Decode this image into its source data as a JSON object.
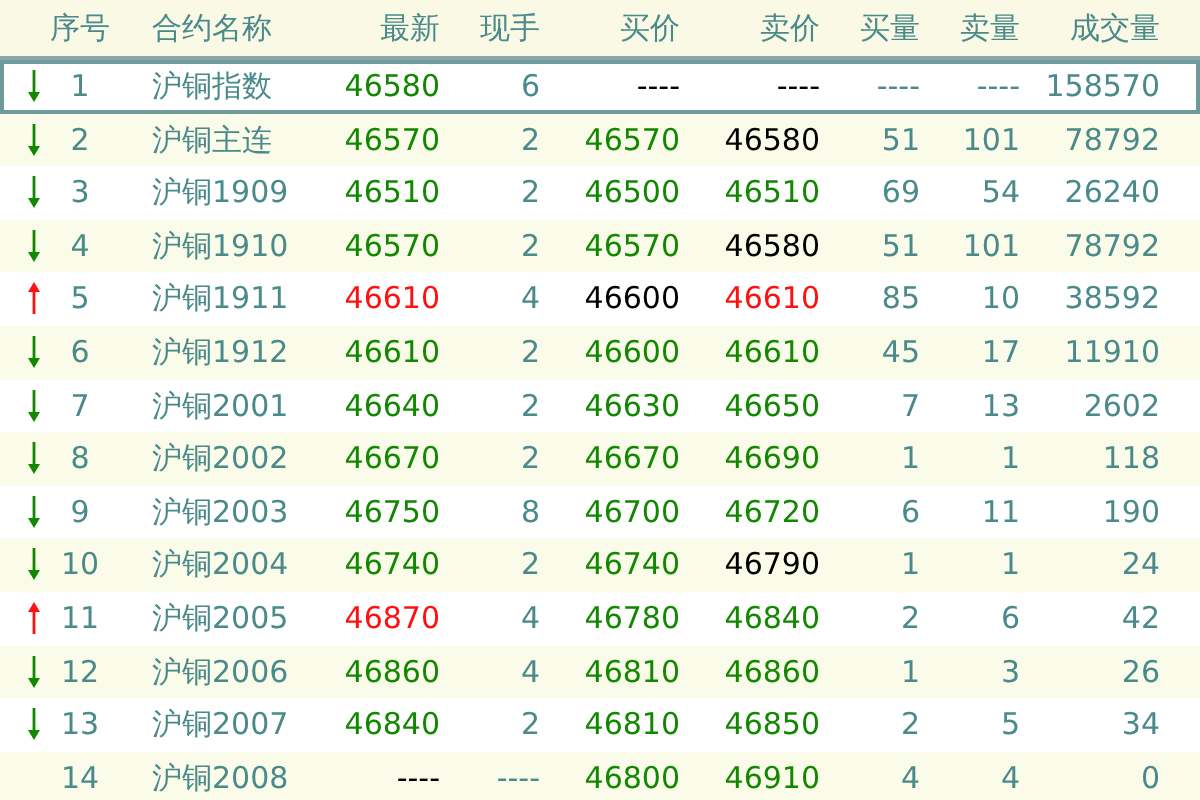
{
  "columns": [
    "序号",
    "合约名称",
    "最新",
    "现手",
    "买价",
    "卖价",
    "买量",
    "卖量",
    "成交量"
  ],
  "rows": [
    {
      "selected": true,
      "arrow": {
        "up": false,
        "color": "#118800"
      },
      "index": "1",
      "name": "沪铜指数",
      "last": {
        "text": "46580",
        "color": "#118800"
      },
      "hand": "6",
      "bid": {
        "text": "----",
        "color": "#000000"
      },
      "ask": {
        "text": "----",
        "color": "#000000"
      },
      "bid_vol": "----",
      "ask_vol": "----",
      "volume": "158570"
    },
    {
      "selected": false,
      "arrow": {
        "up": false,
        "color": "#118800"
      },
      "index": "2",
      "name": "沪铜主连",
      "last": {
        "text": "46570",
        "color": "#118800"
      },
      "hand": "2",
      "bid": {
        "text": "46570",
        "color": "#118800"
      },
      "ask": {
        "text": "46580",
        "color": "#000000"
      },
      "bid_vol": "51",
      "ask_vol": "101",
      "volume": "78792"
    },
    {
      "selected": false,
      "arrow": {
        "up": false,
        "color": "#118800"
      },
      "index": "3",
      "name": "沪铜1909",
      "last": {
        "text": "46510",
        "color": "#118800"
      },
      "hand": "2",
      "bid": {
        "text": "46500",
        "color": "#118800"
      },
      "ask": {
        "text": "46510",
        "color": "#118800"
      },
      "bid_vol": "69",
      "ask_vol": "54",
      "volume": "26240"
    },
    {
      "selected": false,
      "arrow": {
        "up": false,
        "color": "#118800"
      },
      "index": "4",
      "name": "沪铜1910",
      "last": {
        "text": "46570",
        "color": "#118800"
      },
      "hand": "2",
      "bid": {
        "text": "46570",
        "color": "#118800"
      },
      "ask": {
        "text": "46580",
        "color": "#000000"
      },
      "bid_vol": "51",
      "ask_vol": "101",
      "volume": "78792"
    },
    {
      "selected": false,
      "arrow": {
        "up": true,
        "color": "#ff1010"
      },
      "index": "5",
      "name": "沪铜1911",
      "last": {
        "text": "46610",
        "color": "#ff1010"
      },
      "hand": "4",
      "bid": {
        "text": "46600",
        "color": "#000000"
      },
      "ask": {
        "text": "46610",
        "color": "#ff1010"
      },
      "bid_vol": "85",
      "ask_vol": "10",
      "volume": "38592"
    },
    {
      "selected": false,
      "arrow": {
        "up": false,
        "color": "#118800"
      },
      "index": "6",
      "name": "沪铜1912",
      "last": {
        "text": "46610",
        "color": "#118800"
      },
      "hand": "2",
      "bid": {
        "text": "46600",
        "color": "#118800"
      },
      "ask": {
        "text": "46610",
        "color": "#118800"
      },
      "bid_vol": "45",
      "ask_vol": "17",
      "volume": "11910"
    },
    {
      "selected": false,
      "arrow": {
        "up": false,
        "color": "#118800"
      },
      "index": "7",
      "name": "沪铜2001",
      "last": {
        "text": "46640",
        "color": "#118800"
      },
      "hand": "2",
      "bid": {
        "text": "46630",
        "color": "#118800"
      },
      "ask": {
        "text": "46650",
        "color": "#118800"
      },
      "bid_vol": "7",
      "ask_vol": "13",
      "volume": "2602"
    },
    {
      "selected": false,
      "arrow": {
        "up": false,
        "color": "#118800"
      },
      "index": "8",
      "name": "沪铜2002",
      "last": {
        "text": "46670",
        "color": "#118800"
      },
      "hand": "2",
      "bid": {
        "text": "46670",
        "color": "#118800"
      },
      "ask": {
        "text": "46690",
        "color": "#118800"
      },
      "bid_vol": "1",
      "ask_vol": "1",
      "volume": "118"
    },
    {
      "selected": false,
      "arrow": {
        "up": false,
        "color": "#118800"
      },
      "index": "9",
      "name": "沪铜2003",
      "last": {
        "text": "46750",
        "color": "#118800"
      },
      "hand": "8",
      "bid": {
        "text": "46700",
        "color": "#118800"
      },
      "ask": {
        "text": "46720",
        "color": "#118800"
      },
      "bid_vol": "6",
      "ask_vol": "11",
      "volume": "190"
    },
    {
      "selected": false,
      "arrow": {
        "up": false,
        "color": "#118800"
      },
      "index": "10",
      "name": "沪铜2004",
      "last": {
        "text": "46740",
        "color": "#118800"
      },
      "hand": "2",
      "bid": {
        "text": "46740",
        "color": "#118800"
      },
      "ask": {
        "text": "46790",
        "color": "#000000"
      },
      "bid_vol": "1",
      "ask_vol": "1",
      "volume": "24"
    },
    {
      "selected": false,
      "arrow": {
        "up": true,
        "color": "#ff1010"
      },
      "index": "11",
      "name": "沪铜2005",
      "last": {
        "text": "46870",
        "color": "#ff1010"
      },
      "hand": "4",
      "bid": {
        "text": "46780",
        "color": "#118800"
      },
      "ask": {
        "text": "46840",
        "color": "#118800"
      },
      "bid_vol": "2",
      "ask_vol": "6",
      "volume": "42"
    },
    {
      "selected": false,
      "arrow": {
        "up": false,
        "color": "#118800"
      },
      "index": "12",
      "name": "沪铜2006",
      "last": {
        "text": "46860",
        "color": "#118800"
      },
      "hand": "4",
      "bid": {
        "text": "46810",
        "color": "#118800"
      },
      "ask": {
        "text": "46860",
        "color": "#118800"
      },
      "bid_vol": "1",
      "ask_vol": "3",
      "volume": "26"
    },
    {
      "selected": false,
      "arrow": {
        "up": false,
        "color": "#118800"
      },
      "index": "13",
      "name": "沪铜2007",
      "last": {
        "text": "46840",
        "color": "#118800"
      },
      "hand": "2",
      "bid": {
        "text": "46810",
        "color": "#118800"
      },
      "ask": {
        "text": "46850",
        "color": "#118800"
      },
      "bid_vol": "2",
      "ask_vol": "5",
      "volume": "34"
    },
    {
      "selected": false,
      "index": "14",
      "name": "沪铜2008",
      "last": {
        "text": "----",
        "color": "#000000"
      },
      "hand": "----",
      "bid": {
        "text": "46800",
        "color": "#118800"
      },
      "ask": {
        "text": "46910",
        "color": "#118800"
      },
      "bid_vol": "4",
      "ask_vol": "4",
      "volume": "0"
    }
  ]
}
